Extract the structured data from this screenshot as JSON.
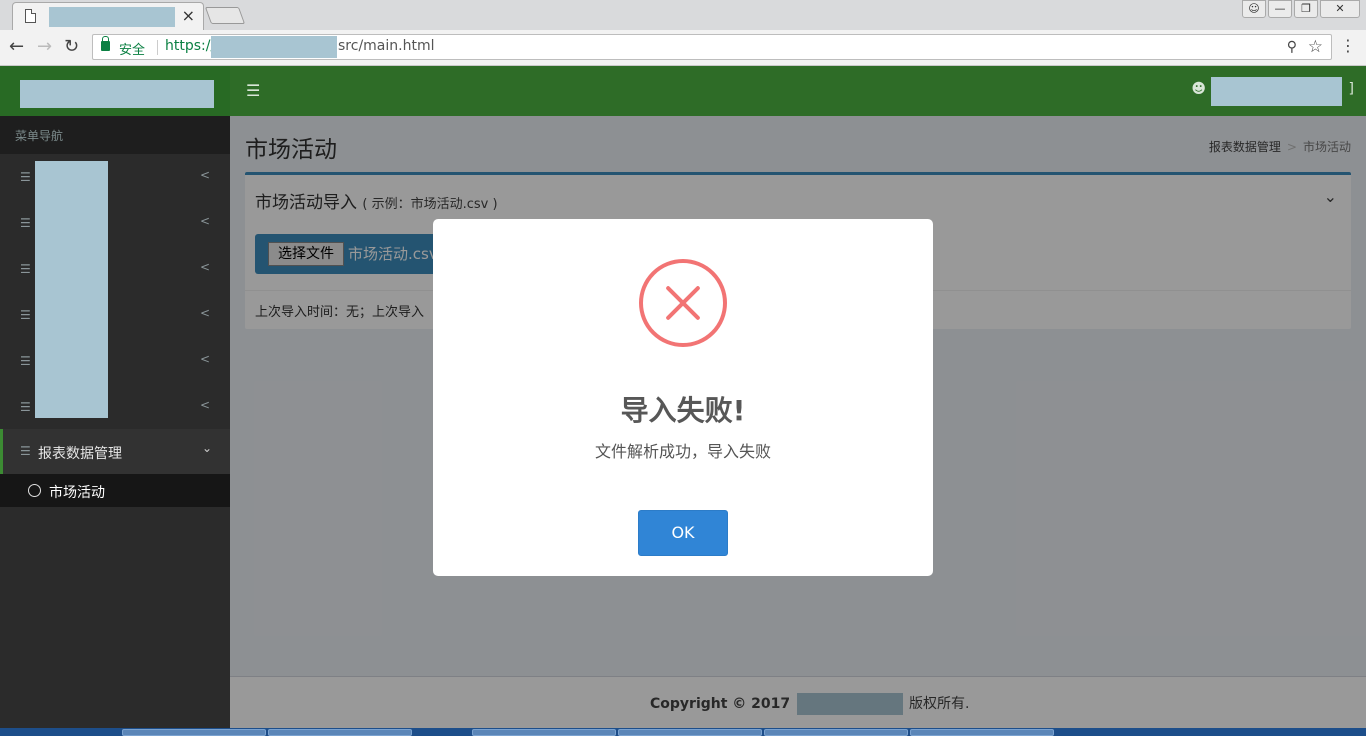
{
  "browser": {
    "tab_close": "×",
    "secure_label": "安全",
    "url_scheme": "https://",
    "url_path": "src/main.html"
  },
  "sidebar": {
    "menu_header": "菜单导航",
    "active_item": "报表数据管理",
    "sub_item": "市场活动"
  },
  "content": {
    "page_title": "市场活动",
    "breadcrumb": {
      "parent": "报表数据管理",
      "separator": ">",
      "current": "市场活动"
    },
    "box": {
      "title": "市场活动导入",
      "hint": "( 示例：市场活动.csv )",
      "file_button": "选择文件",
      "file_name": "市场活动.csv",
      "last_import": "上次导入时间：无；上次导入"
    }
  },
  "footer": {
    "copyright": "Copyright © 2017",
    "rights": "版权所有."
  },
  "modal": {
    "title": "导入失败!",
    "text": "文件解析成功，导入失败",
    "ok_label": "OK"
  },
  "colors": {
    "header_green": "#2e6c27",
    "sidebar_dark": "#2b2b2b",
    "box_border": "#3c8dbc",
    "error_red": "#f27474",
    "ok_blue": "#3085d6"
  }
}
